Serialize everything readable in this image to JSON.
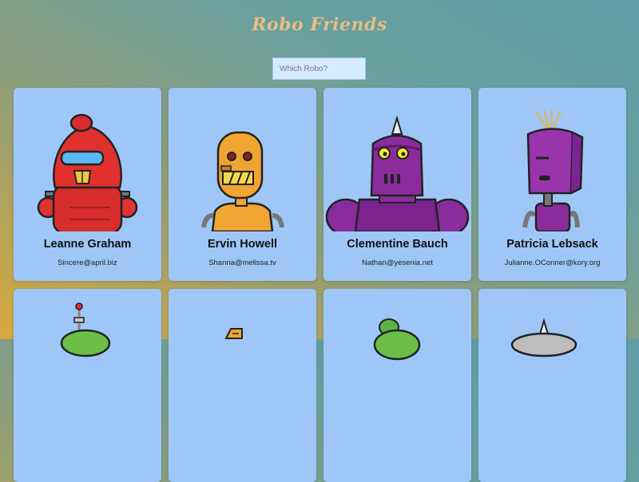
{
  "app": {
    "title": "Robo Friends"
  },
  "search": {
    "placeholder": "Which Robo?"
  },
  "robots": [
    {
      "name": "Leanne Graham",
      "email": "Sincere@april.biz",
      "icon": "red-robot-avatar"
    },
    {
      "name": "Ervin Howell",
      "email": "Shanna@melissa.tv",
      "icon": "orange-robot-avatar"
    },
    {
      "name": "Clementine Bauch",
      "email": "Nathan@yesenia.net",
      "icon": "purple-horned-robot-avatar"
    },
    {
      "name": "Patricia Lebsack",
      "email": "Julianne.OConner@kory.org",
      "icon": "purple-box-robot-avatar"
    }
  ],
  "colors": {
    "card": "#9ec7f7",
    "title": "#e3c089",
    "search_bg": "#d7ebff"
  }
}
